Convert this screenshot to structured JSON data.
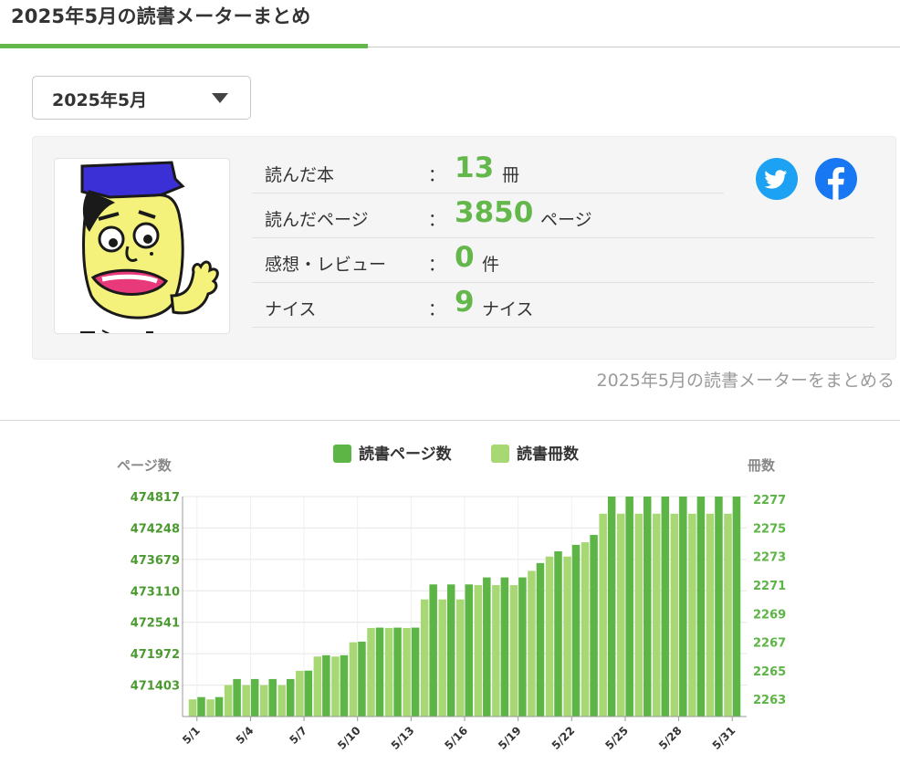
{
  "page": {
    "title": "2025年5月の読書メーターまとめ"
  },
  "month_select": {
    "value": "2025年5月"
  },
  "summary": {
    "stats": [
      {
        "label": "読んだ本",
        "colon": "：",
        "value": "13",
        "unit": "冊"
      },
      {
        "label": "読んだページ",
        "colon": "：",
        "value": "3850",
        "unit": "ページ"
      },
      {
        "label": "感想・レビュー",
        "colon": "：",
        "value": "0",
        "unit": "件"
      },
      {
        "label": "ナイス",
        "colon": "：",
        "value": "9",
        "unit": "ナイス"
      }
    ],
    "share_icons": [
      "twitter-icon",
      "facebook-icon"
    ],
    "link_text": "2025年5月の読書メーターをまとめる"
  },
  "colors": {
    "accent": "#64b74a",
    "pages_bar": "#5cb545",
    "books_bar": "#a8d874",
    "tick_green": "#4a9a2f",
    "twitter": "#1da1f2",
    "facebook": "#1877f2"
  },
  "chart_data": {
    "type": "bar",
    "legend": [
      "読書ページ数",
      "読書冊数"
    ],
    "legend_position": "top-center",
    "ylabel_left": "ページ数",
    "ylabel_right": "冊数",
    "y_left_ticks": [
      "474817",
      "474248",
      "473679",
      "473110",
      "472541",
      "471972",
      "471403"
    ],
    "y_left_range": [
      470834,
      474817
    ],
    "y_right_ticks": [
      "2277",
      "2275",
      "2273",
      "2271",
      "2269",
      "2267",
      "2265",
      "2263"
    ],
    "y_right_range": [
      2261.8,
      2277.2
    ],
    "x_tick_labels": [
      "5/1",
      "5/4",
      "5/7",
      "5/10",
      "5/13",
      "5/16",
      "5/19",
      "5/22",
      "5/25",
      "5/28",
      "5/31"
    ],
    "x_tick_days": [
      1,
      4,
      7,
      10,
      13,
      16,
      19,
      22,
      25,
      28,
      31
    ],
    "categories": [
      "5/1",
      "5/2",
      "5/3",
      "5/4",
      "5/5",
      "5/6",
      "5/7",
      "5/8",
      "5/9",
      "5/10",
      "5/11",
      "5/12",
      "5/13",
      "5/14",
      "5/15",
      "5/16",
      "5/17",
      "5/18",
      "5/19",
      "5/20",
      "5/21",
      "5/22",
      "5/23",
      "5/24",
      "5/25",
      "5/26",
      "5/27",
      "5/28",
      "5/29",
      "5/30",
      "5/31"
    ],
    "grid": true,
    "series": [
      {
        "name": "読書ページ数",
        "axis": "left",
        "values": [
          471186,
          471186,
          471513,
          471513,
          471513,
          471513,
          471665,
          471944,
          471944,
          472190,
          472444,
          472444,
          472444,
          473226,
          473226,
          473226,
          473353,
          473353,
          473353,
          473612,
          473826,
          473943,
          474122,
          474817,
          474817,
          474817,
          474817,
          474817,
          474817,
          474817,
          474817
        ]
      },
      {
        "name": "読書冊数",
        "axis": "right",
        "values": [
          2263,
          2263,
          2264,
          2264,
          2264,
          2264,
          2265,
          2266,
          2266,
          2267,
          2268,
          2268,
          2268,
          2270,
          2270,
          2270,
          2271,
          2271,
          2271,
          2272,
          2273,
          2273,
          2274,
          2276,
          2276,
          2276,
          2276,
          2276,
          2276,
          2276,
          2276
        ]
      }
    ]
  }
}
